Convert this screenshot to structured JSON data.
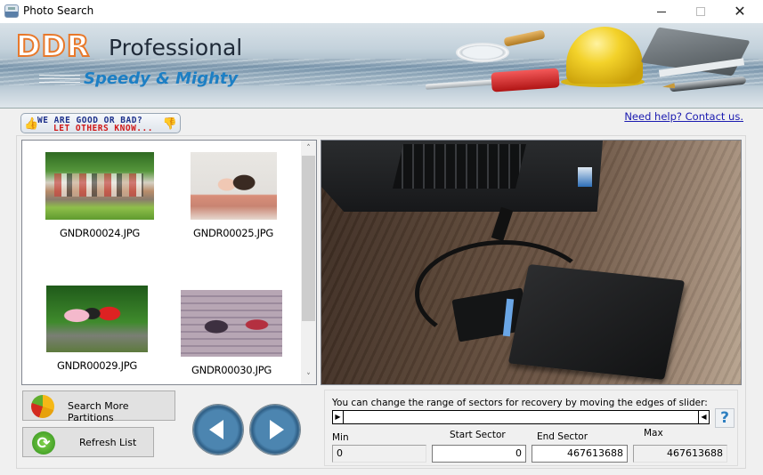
{
  "window": {
    "title": "Photo Search",
    "controls": {
      "minimize": "minimize",
      "maximize": "maximize",
      "close": "✕"
    }
  },
  "banner": {
    "brand": "DDR",
    "product": "Professional",
    "tagline": "Speedy & Mighty"
  },
  "feedback": {
    "line1": "WE ARE GOOD OR BAD?",
    "line2": "LET OTHERS KNOW...",
    "thumb_up_glyph": "👍",
    "thumb_down_glyph": "👎"
  },
  "help_link": "Need help? Contact us.",
  "thumbnails": [
    {
      "filename": "GNDR00024.JPG",
      "subject": "family picnic outdoors"
    },
    {
      "filename": "GNDR00025.JPG",
      "subject": "mother holding baby"
    },
    {
      "filename": "GNDR00029.JPG",
      "subject": "three children sitting on rocks"
    },
    {
      "filename": "GNDR00030.JPG",
      "subject": "two women sitting on steps"
    }
  ],
  "scrollbar": {
    "up_glyph": "˄",
    "down_glyph": "˅"
  },
  "preview": {
    "subject": "laptop connected to external hard drive via USB cable"
  },
  "buttons": {
    "search_partitions": "Search More Partitions",
    "refresh_list": "Refresh List",
    "refresh_glyph": "⟳"
  },
  "sector": {
    "hint": "You can change the range of sectors for recovery by moving the edges of slider:",
    "left_handle_glyph": "▶",
    "right_handle_glyph": "◀",
    "help_glyph": "?",
    "min_label": "Min",
    "start_label": "Start Sector",
    "end_label": "End Sector",
    "max_label": "Max",
    "min_value": "0",
    "start_value": "0",
    "end_value": "467613688",
    "max_value": "467613688"
  }
}
